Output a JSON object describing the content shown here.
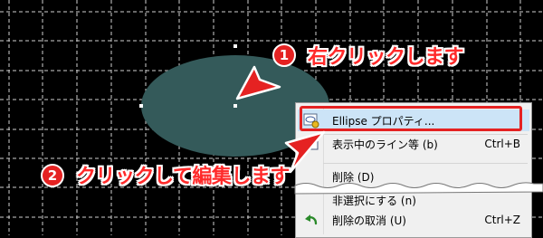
{
  "annotations": {
    "step1": {
      "number": "1",
      "text": "右クリックします"
    },
    "step2": {
      "number": "2",
      "text": "クリックして編集します"
    }
  },
  "context_menu": {
    "items": [
      {
        "label": "Ellipse プロパティ...",
        "shortcut": "",
        "icon": "ellipse-properties-icon",
        "highlighted": true
      },
      {
        "label": "表示中のライン等 (b)",
        "shortcut": "Ctrl+B",
        "icon": "chart-lines-icon"
      },
      {
        "label": "削除 (D)",
        "shortcut": "",
        "icon": ""
      },
      {
        "label": "非選択にする (n)",
        "shortcut": "",
        "icon": ""
      },
      {
        "label": "削除の取消 (U)",
        "shortcut": "Ctrl+Z",
        "icon": "undo-icon"
      }
    ]
  },
  "colors": {
    "background": "#000000",
    "grid": "#ffffff",
    "ellipse_fill": "#345a5a",
    "annotation": "#e52222",
    "menu_background": "#f0f0f0",
    "menu_highlight": "#cce4f7"
  }
}
